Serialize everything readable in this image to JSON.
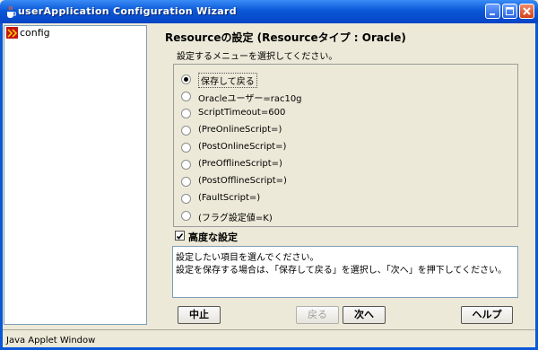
{
  "window": {
    "title": "userApplication Configuration Wizard",
    "status_text": "Java Applet Window"
  },
  "tree": {
    "items": [
      {
        "label": "config",
        "icon": "config-node-icon"
      }
    ]
  },
  "main": {
    "title": "Resourceの設定 (Resourceタイプ : Oracle)",
    "subtitle": "設定するメニューを選択してください。",
    "options": [
      {
        "label": "保存して戻る",
        "selected": true
      },
      {
        "label": "Oracleユーザー=rac10g",
        "selected": false
      },
      {
        "label": "ScriptTimeout=600",
        "selected": false
      },
      {
        "label": "(PreOnlineScript=)",
        "selected": false
      },
      {
        "label": "(PostOnlineScript=)",
        "selected": false
      },
      {
        "label": "(PreOfflineScript=)",
        "selected": false
      },
      {
        "label": "(PostOfflineScript=)",
        "selected": false
      },
      {
        "label": "(FaultScript=)",
        "selected": false
      },
      {
        "label": "(フラグ設定値=K)",
        "selected": false
      }
    ],
    "advanced": {
      "label": "高度な設定",
      "checked": true
    },
    "help_lines": [
      "設定したい項目を選んでください。",
      "設定を保存する場合は、「保存して戻る」を選択し、「次へ」を押下してください。"
    ]
  },
  "buttons": {
    "abort": "中止",
    "back": "戻る",
    "next": "次へ",
    "help": "ヘルプ"
  },
  "colors": {
    "titlebar": "#0a58d8",
    "background": "#ece9d8"
  }
}
